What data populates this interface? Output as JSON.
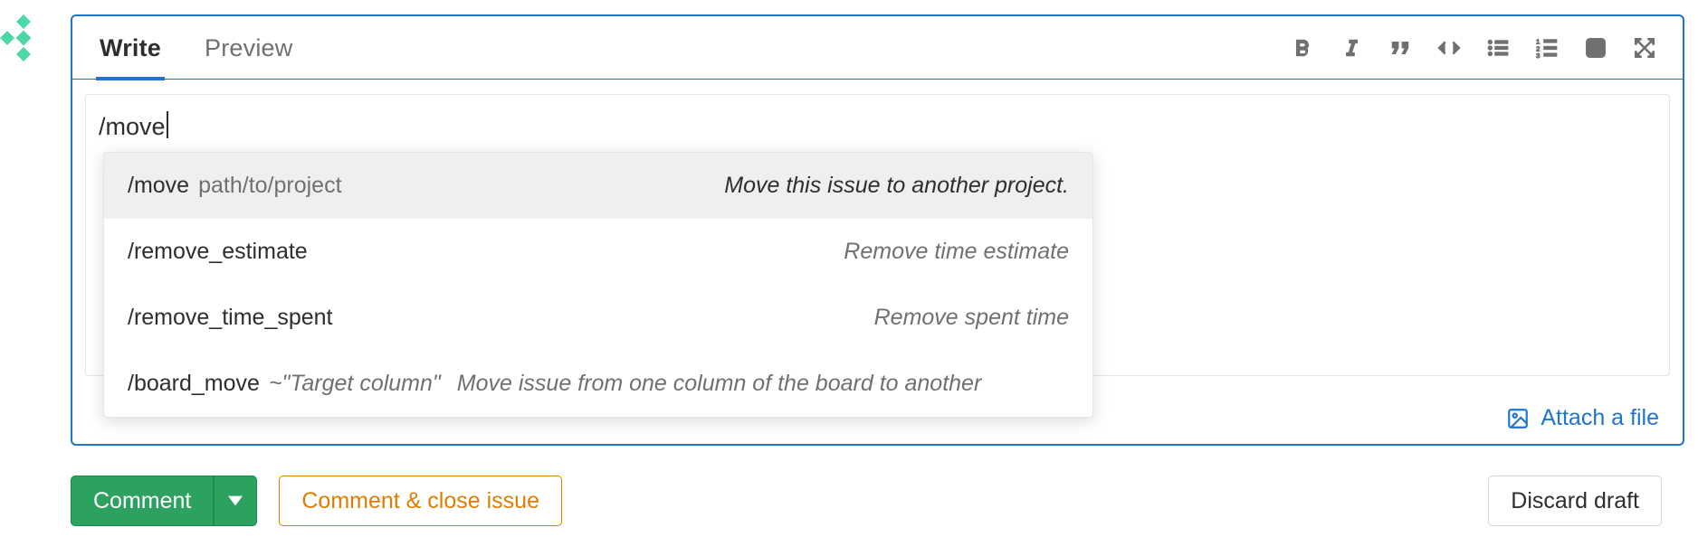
{
  "tabs": {
    "write": "Write",
    "preview": "Preview"
  },
  "toolbar_icons": {
    "bold": "bold",
    "italic": "italic",
    "quote": "quote",
    "code": "code",
    "ul": "bullet-list",
    "ol": "numbered-list",
    "task": "task-list",
    "full": "fullscreen"
  },
  "input_value": "/move",
  "attach_label": "Attach a file",
  "autocomplete": [
    {
      "cmd": "/move",
      "param": "path/to/project",
      "param_style": "plain",
      "desc": "Move this issue to another project.",
      "active": true,
      "layout": "spread"
    },
    {
      "cmd": "/remove_estimate",
      "param": "",
      "param_style": "plain",
      "desc": "Remove time estimate",
      "active": false,
      "layout": "spread"
    },
    {
      "cmd": "/remove_time_spent",
      "param": "",
      "param_style": "plain",
      "desc": "Remove spent time",
      "active": false,
      "layout": "spread"
    },
    {
      "cmd": "/board_move",
      "param": "~\"Target column\"",
      "param_style": "quoted",
      "desc": "Move issue from one column of the board to another",
      "active": false,
      "layout": "tight"
    }
  ],
  "buttons": {
    "comment": "Comment",
    "comment_close": "Comment & close issue",
    "discard": "Discard draft"
  }
}
